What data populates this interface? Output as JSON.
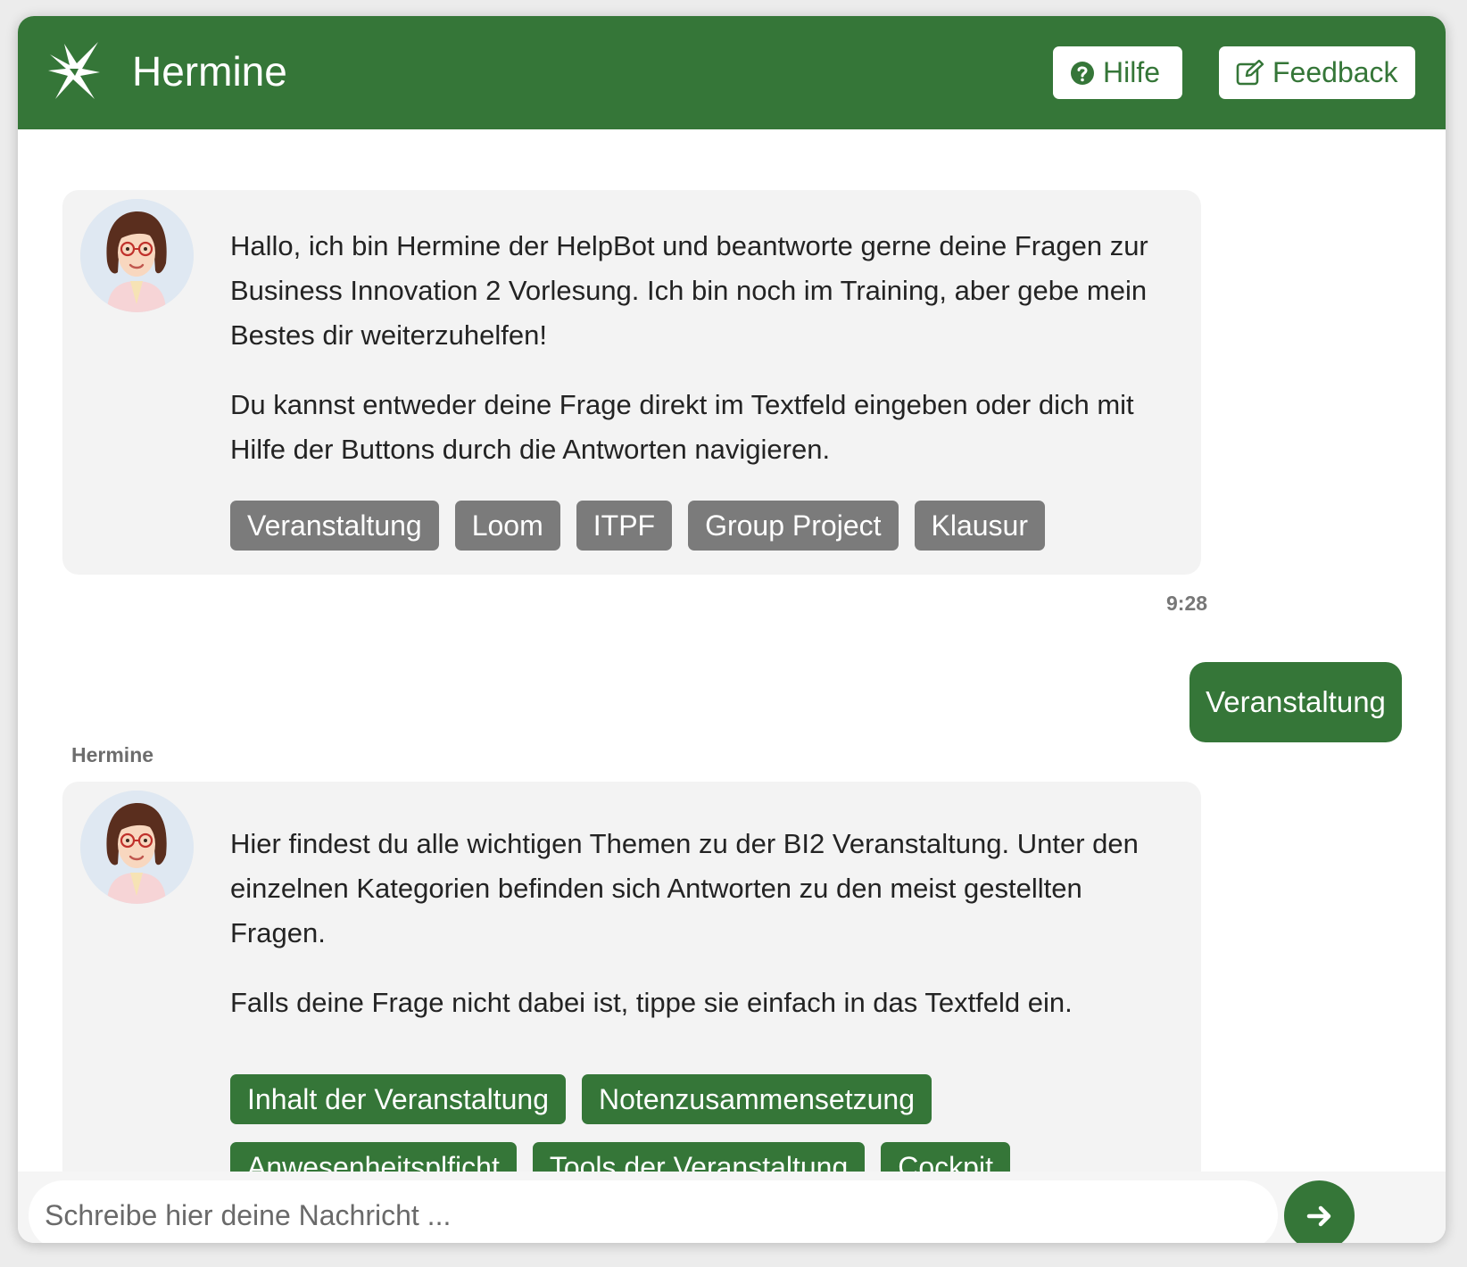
{
  "header": {
    "title": "Hermine",
    "help_label": "Hilfe",
    "feedback_label": "Feedback",
    "logo_icon": "hermine-logo-icon",
    "help_icon": "question-circle-icon",
    "feedback_icon": "edit-icon"
  },
  "colors": {
    "brand_green": "#357638",
    "bubble_grey": "#f3f3f3",
    "chip_grey": "#7b7b7b"
  },
  "chat": {
    "messages": [
      {
        "sender": "bot",
        "paragraphs": [
          "Hallo, ich bin Hermine der HelpBot und beantworte gerne deine Fragen zur Business Innovation 2 Vorlesung. Ich bin noch im Training, aber gebe mein Bestes dir weiterzuhelfen!",
          "Du kannst entweder deine Frage direkt im Textfeld eingeben oder dich mit Hilfe der Buttons durch die Antworten navigieren."
        ],
        "buttons": [
          "Veranstaltung",
          "Loom",
          "ITPF",
          "Group Project",
          "Klausur"
        ],
        "time": "9:28"
      },
      {
        "sender": "user",
        "text": "Veranstaltung"
      },
      {
        "sender": "bot",
        "sender_name": "Hermine",
        "paragraphs": [
          "Hier findest du alle wichtigen Themen zu der BI2 Veranstaltung. Unter den einzelnen Kategorien befinden sich Antworten zu den meist gestellten Fragen.",
          "Falls deine Frage nicht dabei ist, tippe sie einfach in das Textfeld ein."
        ],
        "buttons_row1": [
          "Inhalt der Veranstaltung",
          "Notenzusammensetzung"
        ],
        "buttons_row2": [
          "Anwesenheitsplficht",
          "Tools der Veranstaltung",
          "Cockpit"
        ]
      }
    ]
  },
  "input": {
    "placeholder": "Schreibe hier deine Nachricht ...",
    "value": "",
    "send_icon": "arrow-right-icon"
  }
}
